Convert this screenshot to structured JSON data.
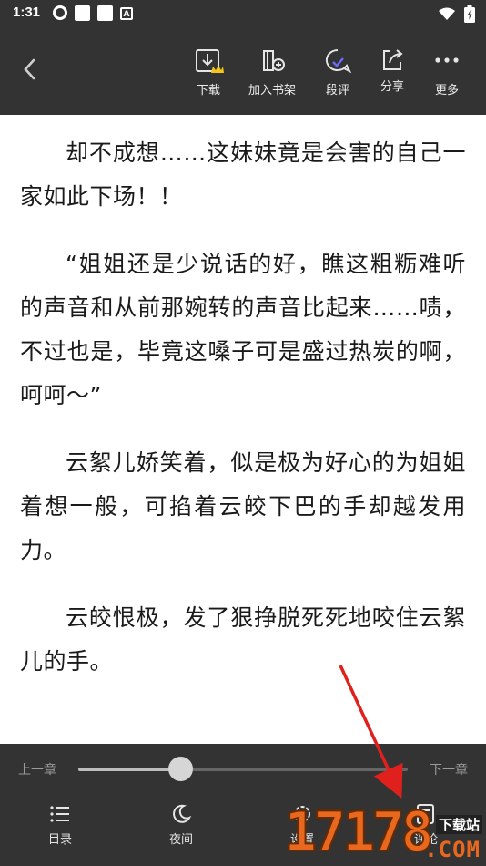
{
  "status_bar": {
    "time": "1:31",
    "notification_letter": "A"
  },
  "toolbar": {
    "back_icon": "chevron-left-icon",
    "actions": [
      {
        "label": "下载",
        "icon": "download-icon"
      },
      {
        "label": "加入书架",
        "icon": "add-bookshelf-icon"
      },
      {
        "label": "段评",
        "icon": "comment-icon"
      },
      {
        "label": "分享",
        "icon": "share-icon"
      },
      {
        "label": "更多",
        "icon": "more-icon"
      }
    ]
  },
  "content": {
    "paragraphs": [
      "却不成想……这妹妹竟是会害的自己一家如此下场！！",
      "“姐姐还是少说话的好，瞧这粗粝难听的声音和从前那婉转的声音比起来……啧，不过也是，毕竟这嗓子可是盛过热炭的啊，呵呵～”",
      "云絮儿娇笑着，似是极为好心的为姐姐着想一般，可掐着云皎下巴的手却越发用力。",
      "云皎恨极，发了狠挣脱死死地咬住云絮儿的手。"
    ]
  },
  "progress": {
    "prev_label": "上一章",
    "next_label": "下一章",
    "position": 0.31
  },
  "bottom_nav": {
    "items": [
      {
        "label": "目录",
        "icon": "list-icon"
      },
      {
        "label": "夜间",
        "icon": "moon-icon"
      },
      {
        "label": "设置",
        "icon": "gear-icon"
      },
      {
        "label": "评论",
        "icon": "note-icon"
      }
    ]
  },
  "watermark": {
    "number": "17178",
    "site": "下载站",
    "domain": ".COM"
  },
  "colors": {
    "bar_background": "#333333",
    "page_background": "#ffffff",
    "text": "#1a1a1a",
    "arrow": "#e0201c",
    "watermark": "#e8681f"
  }
}
